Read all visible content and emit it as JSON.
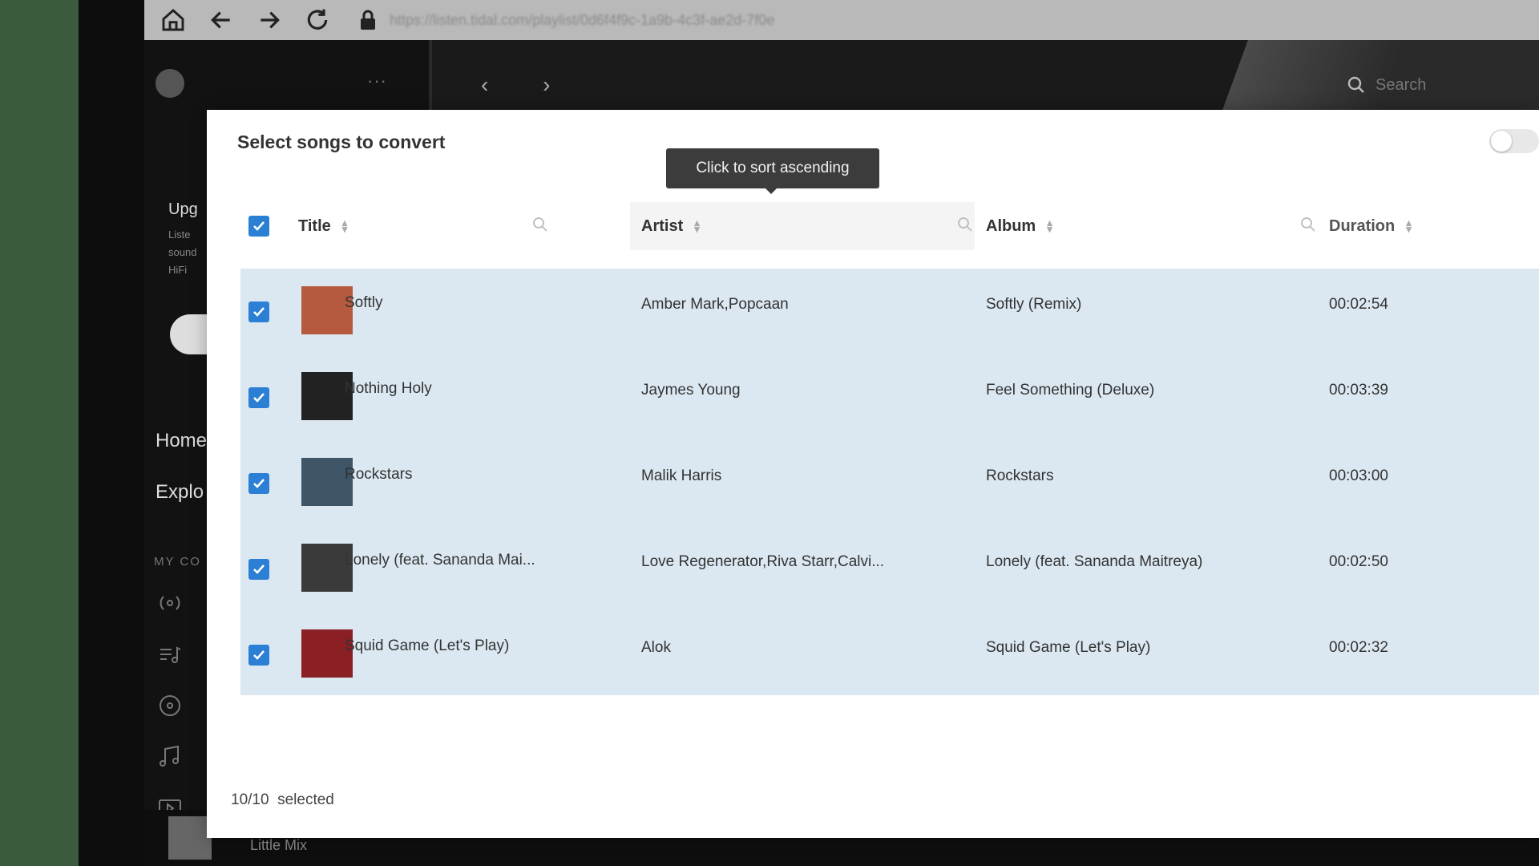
{
  "browser": {
    "url": "https://listen.tidal.com/playlist/0d6f4f9c-1a9b-4c3f-ae2d-7f0e"
  },
  "app": {
    "search_placeholder": "Search",
    "sidebar": {
      "upgrade": "Upg",
      "upgrade_sub": [
        "Liste",
        "sound",
        "HiFi"
      ],
      "home": "Home",
      "explore": "Explo",
      "my_collection": "MY CO"
    },
    "now_playing": "Little Mix"
  },
  "modal": {
    "title": "Select songs to convert",
    "tooltip": "Click to sort ascending",
    "columns": {
      "title": "Title",
      "artist": "Artist",
      "album": "Album",
      "duration": "Duration"
    },
    "rows": [
      {
        "title": "Softly",
        "artist": "Amber Mark,Popcaan",
        "album": "Softly (Remix)",
        "duration": "00:02:54",
        "checked": true,
        "thumb_color": "#b65a3f"
      },
      {
        "title": "Nothing Holy",
        "artist": "Jaymes Young",
        "album": "Feel Something (Deluxe)",
        "duration": "00:03:39",
        "checked": true,
        "thumb_color": "#222222"
      },
      {
        "title": "Rockstars",
        "artist": "Malik Harris",
        "album": "Rockstars",
        "duration": "00:03:00",
        "checked": true,
        "thumb_color": "#3d5566"
      },
      {
        "title": "Lonely (feat. Sananda Mai...",
        "artist": "Love Regenerator,Riva Starr,Calvi...",
        "album": "Lonely (feat. Sananda Maitreya)",
        "duration": "00:02:50",
        "checked": true,
        "thumb_color": "#3a3a3a"
      },
      {
        "title": "Squid Game (Let's Play)",
        "artist": "Alok",
        "album": "Squid Game (Let's Play)",
        "duration": "00:02:32",
        "checked": true,
        "thumb_color": "#8a1f24"
      }
    ],
    "selected_count": "10/10",
    "selected_label": "selected"
  },
  "colors": {
    "checkbox": "#2b7fd4",
    "row_highlight": "#dbe8f1"
  }
}
